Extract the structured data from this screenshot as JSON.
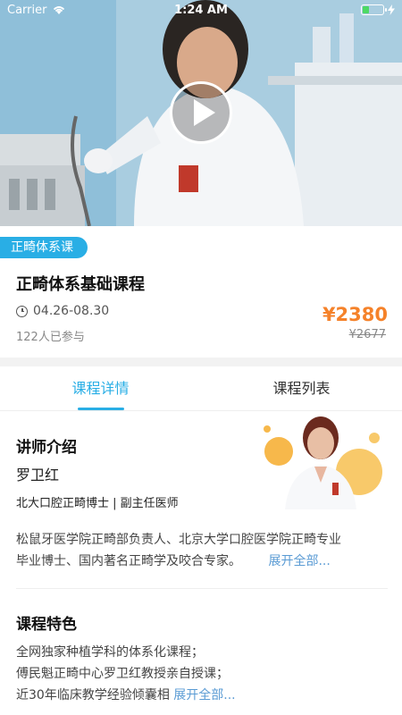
{
  "status_bar": {
    "carrier": "Carrier",
    "time": "1:24 AM",
    "battery_level": 0.35
  },
  "hero": {
    "play_icon": "play-icon"
  },
  "course": {
    "tag": "正畸体系课",
    "title": "正畸体系基础课程",
    "date_range": "04.26-08.30",
    "participants": "122人已参与",
    "price": "¥2380",
    "original_price": "¥2677"
  },
  "tabs": [
    {
      "label": "课程详情"
    },
    {
      "label": "课程列表"
    }
  ],
  "instructor": {
    "section_title": "讲师介绍",
    "name": "罗卫红",
    "role": "北大口腔正畸博士 | 副主任医师",
    "bio_line1": "松鼠牙医学院正畸部负责人、北京大学口腔医学院正畸专业",
    "bio_line2": "毕业博士、国内著名正畸学及咬合专家。",
    "expand": "展开全部..."
  },
  "features": {
    "section_title": "课程特色",
    "line1": "全网独家种植学科的体系化课程；",
    "line2": "傅民魁正畸中心罗卫红教授亲自授课；",
    "line3": "近30年临床教学经验倾囊相",
    "expand": "展开全部..."
  }
}
